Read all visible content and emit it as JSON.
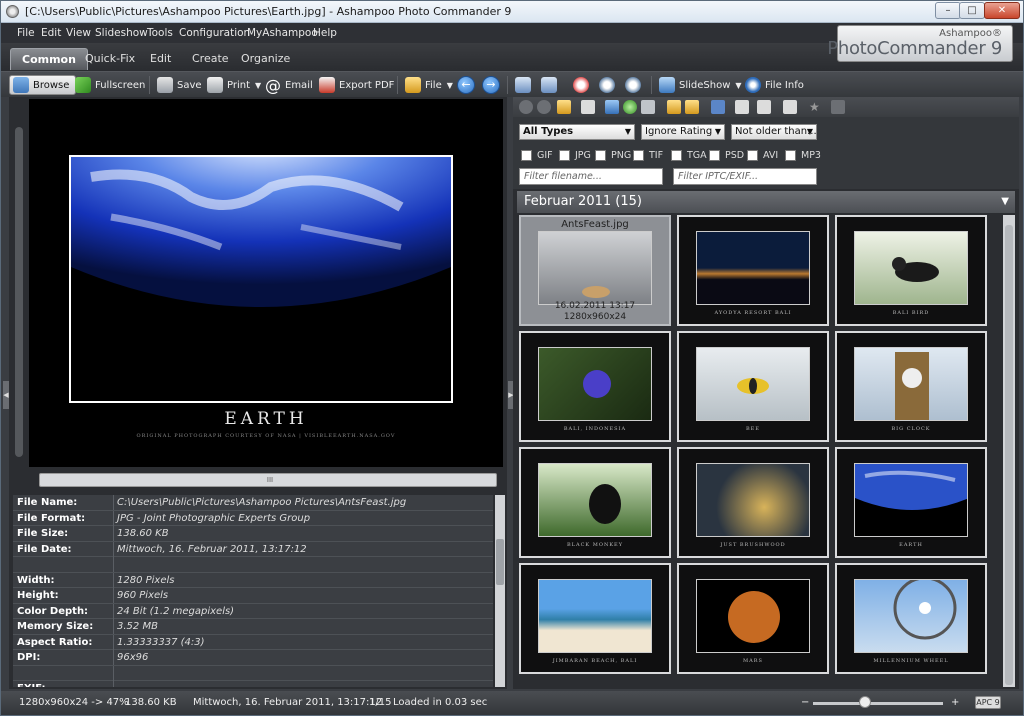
{
  "window": {
    "title": "[C:\\Users\\Public\\Pictures\\Ashampoo Pictures\\Earth.jpg] - Ashampoo Photo Commander 9",
    "controls": {
      "minimize": "–",
      "maximize": "□",
      "close": "✕"
    }
  },
  "menu": [
    "File",
    "Edit",
    "View",
    "Slideshow",
    "Tools",
    "Configuration",
    "MyAshampoo",
    "Help"
  ],
  "ribbon_tabs": [
    {
      "label": "Common",
      "active": true
    },
    {
      "label": "Quick-Fix",
      "active": false
    },
    {
      "label": "Edit",
      "active": false
    },
    {
      "label": "Create",
      "active": false
    },
    {
      "label": "Organize",
      "active": false
    }
  ],
  "logo": {
    "brand": "Ashampoo®",
    "product": "PhotoCommander 9"
  },
  "toolbar": {
    "browse": "Browse",
    "fullscreen": "Fullscreen",
    "save": "Save",
    "print": "Print",
    "email": "Email",
    "export_pdf": "Export PDF",
    "file": "File",
    "slideshow": "SlideShow",
    "file_info": "File Info",
    "back_glyph": "←",
    "forward_glyph": "→"
  },
  "viewer": {
    "caption": "EARTH",
    "credit": "ORIGINAL PHOTOGRAPH COURTESY OF NASA | VISIBLEEARTH.NASA.GOV",
    "scroll_grip": "III"
  },
  "file_info": [
    {
      "key": "File Name:",
      "value": "C:\\Users\\Public\\Pictures\\Ashampoo Pictures\\AntsFeast.jpg"
    },
    {
      "key": "File Format:",
      "value": "JPG - Joint Photographic Experts Group"
    },
    {
      "key": "File Size:",
      "value": "138.60 KB"
    },
    {
      "key": "File Date:",
      "value": "Mittwoch, 16. Februar 2011, 13:17:12"
    },
    {
      "key": "",
      "value": ""
    },
    {
      "key": "Width:",
      "value": "1280 Pixels"
    },
    {
      "key": "Height:",
      "value": "960 Pixels"
    },
    {
      "key": "Color Depth:",
      "value": "24 Bit (1.2 megapixels)"
    },
    {
      "key": "Memory Size:",
      "value": "3.52 MB"
    },
    {
      "key": "Aspect Ratio:",
      "value": "1.33333337 (4:3)"
    },
    {
      "key": "DPI:",
      "value": "96x96"
    },
    {
      "key": "",
      "value": ""
    },
    {
      "key": "EXIF:",
      "value": ""
    }
  ],
  "filters": {
    "type": "All Types",
    "rating": "Ignore Rating",
    "age": "Not older than...",
    "formats": [
      "GIF",
      "JPG",
      "PNG",
      "TIF",
      "TGA",
      "PSD",
      "AVI",
      "MP3"
    ],
    "filename_placeholder": "Filter filename...",
    "iptc_placeholder": "Filter IPTC/EXIF..."
  },
  "group": {
    "label": "Februar 2011 (15)"
  },
  "thumbnails": [
    {
      "label": "",
      "name": "AntsFeast.jpg",
      "date": "16.02.2011 13:17",
      "dims": "1280x960x24",
      "selected": true
    },
    {
      "label": "AYODYA RESORT BALI"
    },
    {
      "label": "BALI BIRD"
    },
    {
      "label": "BALI, INDONESIA"
    },
    {
      "label": "BEE"
    },
    {
      "label": "BIG CLOCK"
    },
    {
      "label": "BLACK MONKEY"
    },
    {
      "label": "JUST BRUSHWOOD"
    },
    {
      "label": "EARTH"
    },
    {
      "label": "JIMBARAN BEACH, BALI"
    },
    {
      "label": "MARS"
    },
    {
      "label": "MILLENNIUM WHEEL"
    }
  ],
  "status": {
    "dims": "1280x960x24 -> 47%",
    "size": "138.60 KB",
    "date": "Mittwoch, 16. Februar 2011, 13:17:12",
    "count": "1/15",
    "loaded": "Loaded in 0.03 sec",
    "zoom_minus": "−",
    "zoom_plus": "+",
    "apc": "APC 9"
  }
}
